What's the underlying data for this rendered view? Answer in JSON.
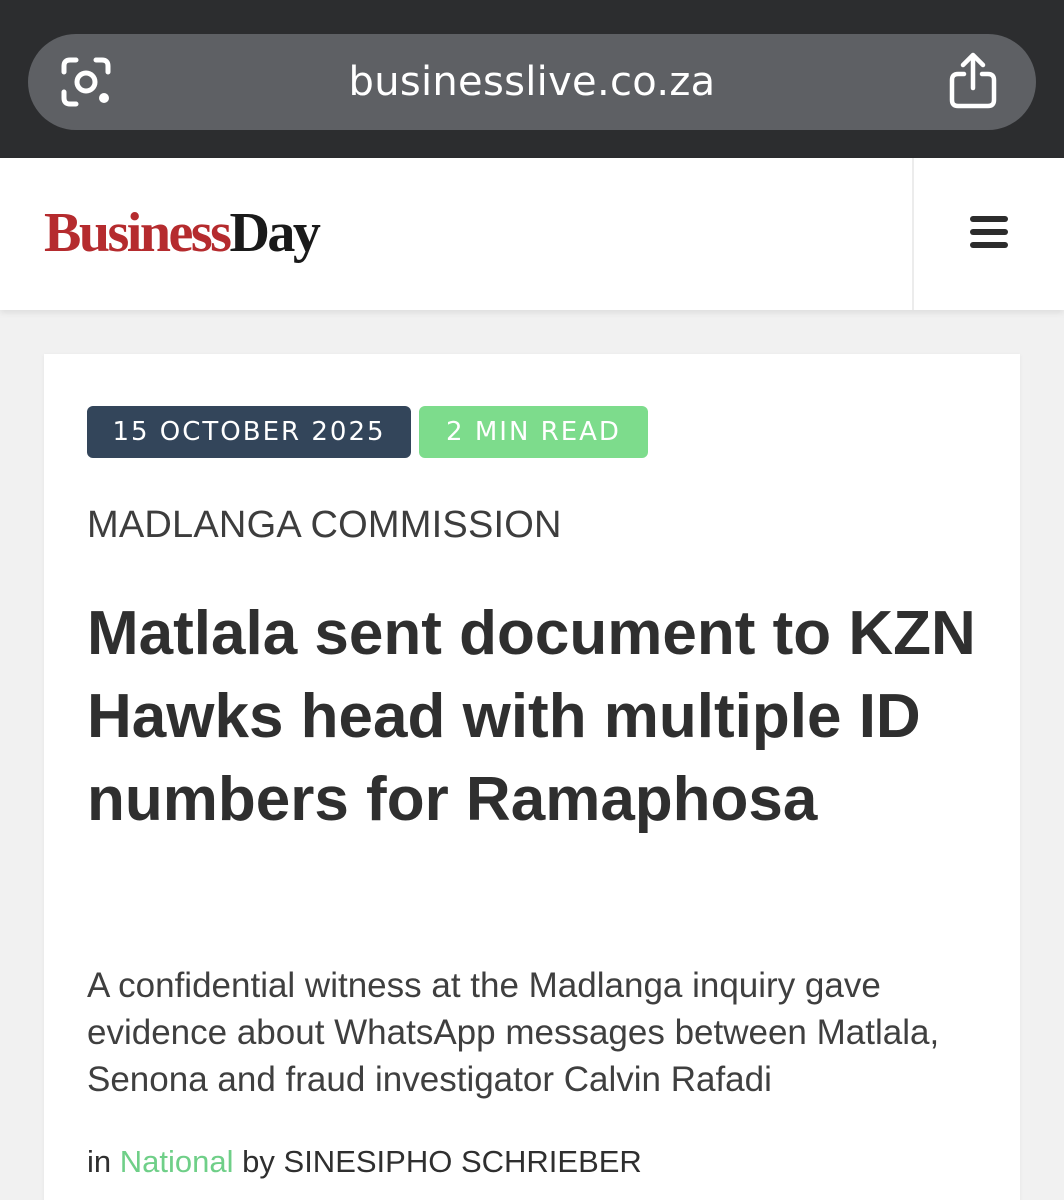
{
  "browser": {
    "url": "businesslive.co.za",
    "left_icon": "visual-lookup-icon",
    "right_icon": "share-icon"
  },
  "header": {
    "logo_part1": "Business",
    "logo_part2": "Day",
    "logo_colors": {
      "business": "#b52b2e",
      "day": "#1a1a1a"
    },
    "menu_icon": "hamburger-menu-icon"
  },
  "article": {
    "date": "15 OCTOBER 2025",
    "read_time": "2 MIN READ",
    "section": "MADLANGA COMMISSION",
    "headline": "Matlala sent document to KZN Hawks head with multiple ID numbers for Ramaphosa",
    "standfirst": "A confidential witness at the Madlanga inquiry gave evidence about WhatsApp messages between Matlala, Senona and fraud investigator Calvin Rafadi",
    "byline": {
      "in_label": "in",
      "category": "National",
      "by_label": "by",
      "author": "SINESIPHO SCHRIEBER"
    }
  },
  "colors": {
    "date_badge": "#33455a",
    "read_badge": "#7ddc8c",
    "category_link": "#6fcf88"
  }
}
